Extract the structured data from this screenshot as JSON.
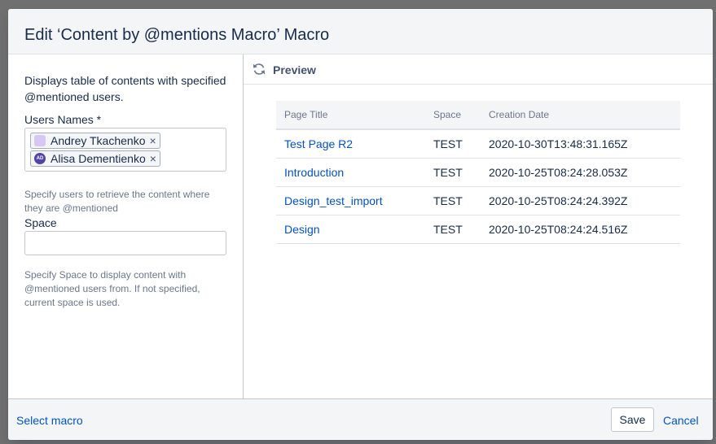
{
  "dialog": {
    "title": "Edit ‘Content by @mentions Macro’ Macro"
  },
  "left": {
    "description": "Displays table of contents with specified @mentioned users.",
    "users_label": "Users Names *",
    "users": [
      {
        "name": "Andrey Tkachenko",
        "avatar_text": "",
        "avatar_icon": "user-avatar-icon"
      },
      {
        "name": "Alisa Dementienko",
        "avatar_text": "AD",
        "avatar_icon": "user-initials-avatar-icon"
      }
    ],
    "remove_glyph": "×",
    "users_help": "Specify users to retrieve the content where they are @mentioned",
    "space_label": "Space",
    "space_value": "",
    "space_help": "Specify Space to display content with @mentioned users from. If not specified, current space is used."
  },
  "preview": {
    "label": "Preview",
    "icon": "refresh-icon",
    "columns": [
      "Page Title",
      "Space",
      "Creation Date"
    ],
    "rows": [
      {
        "title": "Test Page R2",
        "space": "TEST",
        "date": "2020-10-30T13:48:31.165Z"
      },
      {
        "title": "Introduction",
        "space": "TEST",
        "date": "2020-10-25T08:24:28.053Z"
      },
      {
        "title": "Design_test_import",
        "space": "TEST",
        "date": "2020-10-25T08:24:24.392Z"
      },
      {
        "title": "Design",
        "space": "TEST",
        "date": "2020-10-25T08:24:24.516Z"
      }
    ]
  },
  "footer": {
    "select_macro": "Select macro",
    "save": "Save",
    "cancel": "Cancel"
  },
  "colors": {
    "link": "#0052cc",
    "text": "#172b4d",
    "header_bg": "#f4f5f7",
    "overlay": "#707070"
  }
}
